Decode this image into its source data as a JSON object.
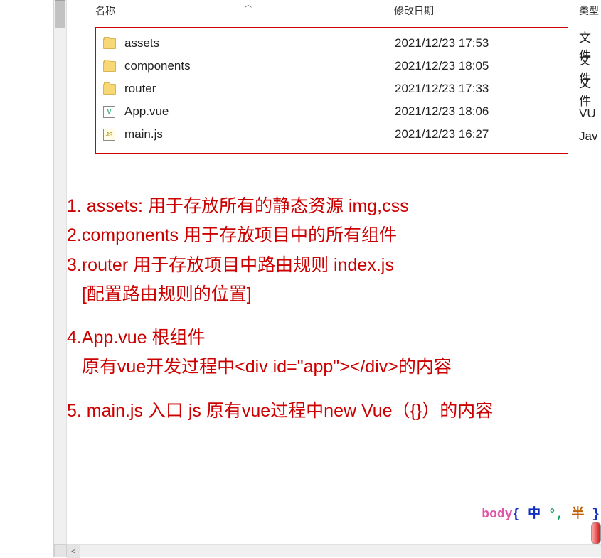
{
  "header": {
    "name": "名称",
    "date": "修改日期",
    "type": "类型"
  },
  "files": [
    {
      "icon": "folder",
      "name": "assets",
      "date": "2021/12/23 17:53",
      "type": "文件"
    },
    {
      "icon": "folder",
      "name": "components",
      "date": "2021/12/23 18:05",
      "type": "文件"
    },
    {
      "icon": "folder",
      "name": "router",
      "date": "2021/12/23 17:33",
      "type": "文件"
    },
    {
      "icon": "vue",
      "name": "App.vue",
      "date": "2021/12/23 18:06",
      "type": "VU"
    },
    {
      "icon": "js",
      "name": "main.js",
      "date": "2021/12/23 16:27",
      "type": "Jav"
    }
  ],
  "notes": {
    "l1": "1. assets: 用于存放所有的静态资源 img,css",
    "l2": "2.components 用于存放项目中的所有组件",
    "l3": "3.router 用于存放项目中路由规则 index.js",
    "l4": "   [配置路由规则的位置]",
    "l5": "4.App.vue 根组件",
    "l6": "   原有vue开发过程中<div id=\"app\"></div>的内容",
    "l7": "5. main.js 入口 js 原有vue过程中new Vue（{}）的内容"
  },
  "ime": {
    "body": "body",
    "lbrace": "{",
    "ch": "中",
    "punc": "°,",
    "half": "半",
    "rbrace": "}"
  }
}
